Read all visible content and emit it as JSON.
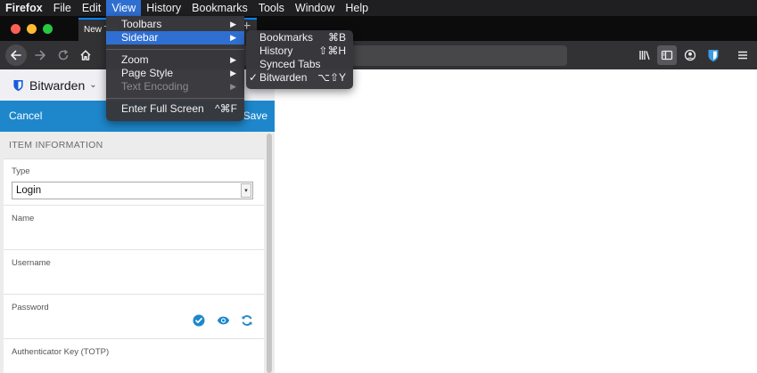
{
  "menubar": {
    "items": [
      "Firefox",
      "File",
      "Edit",
      "View",
      "History",
      "Bookmarks",
      "Tools",
      "Window",
      "Help"
    ]
  },
  "tabs": [
    {
      "label": "New Tab"
    }
  ],
  "view_menu": {
    "items": [
      {
        "label": "Toolbars"
      },
      {
        "label": "Sidebar"
      },
      {
        "label": "Zoom"
      },
      {
        "label": "Page Style"
      },
      {
        "label": "Text Encoding"
      },
      {
        "label": "Enter Full Screen",
        "shortcut": "^⌘F"
      }
    ]
  },
  "sidebar_menu": {
    "items": [
      {
        "label": "Bookmarks",
        "shortcut": "⌘B"
      },
      {
        "label": "History",
        "shortcut": "⇧⌘H"
      },
      {
        "label": "Synced Tabs",
        "shortcut": ""
      },
      {
        "label": "Bitwarden",
        "shortcut": "⌥⇧Y",
        "checked": true
      }
    ]
  },
  "sidebar": {
    "header_title": "Bitwarden",
    "cancel_label": "Cancel",
    "save_label": "Save",
    "section_title": "ITEM INFORMATION",
    "fields": {
      "type_label": "Type",
      "type_value": "Login",
      "name_label": "Name",
      "username_label": "Username",
      "password_label": "Password",
      "totp_label": "Authenticator Key (TOTP)"
    }
  },
  "colors": {
    "accent": "#2f6fd2",
    "bitwarden_blue": "#1e87cc",
    "toolbar": "#323234"
  },
  "icons": [
    "back-icon",
    "forward-icon",
    "reload-icon",
    "home-icon",
    "library-icon",
    "sidebar-icon",
    "account-icon",
    "bitwarden-icon",
    "hamburger-menu-icon",
    "check-circle-icon",
    "eye-icon",
    "refresh-icon",
    "chevron-down-icon",
    "submenu-arrow-icon",
    "checkmark-icon"
  ]
}
